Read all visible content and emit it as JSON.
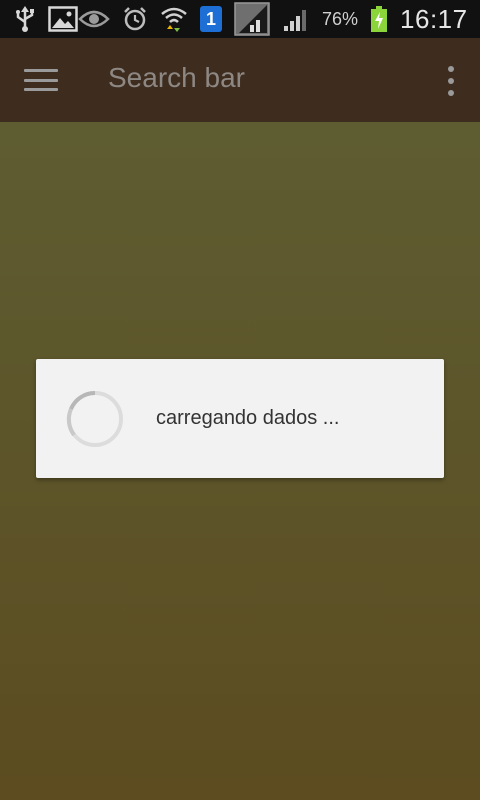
{
  "status_bar": {
    "icons_left": [
      "usb-icon",
      "image-notification-icon",
      "eye-icon",
      "alarm-icon",
      "wifi-icon",
      "sim-1-icon",
      "network-icon",
      "signal-icon"
    ],
    "sim_label": "1",
    "battery_percent": "76%",
    "time": "16:17"
  },
  "app_bar": {
    "title": "Search bar",
    "menu_icon": "hamburger-menu-icon",
    "overflow_icon": "more-vert-icon"
  },
  "loading_dialog": {
    "message": "carregando dados ..."
  },
  "colors": {
    "status_bar": "#111111",
    "app_bar": "#3e2d1f",
    "background_top": "#5e5f34",
    "background_bottom": "#5c4c20",
    "dialog": "#f2f2f2",
    "battery_charge": "#8bd43a",
    "sim_badge": "#1d6fd6"
  }
}
